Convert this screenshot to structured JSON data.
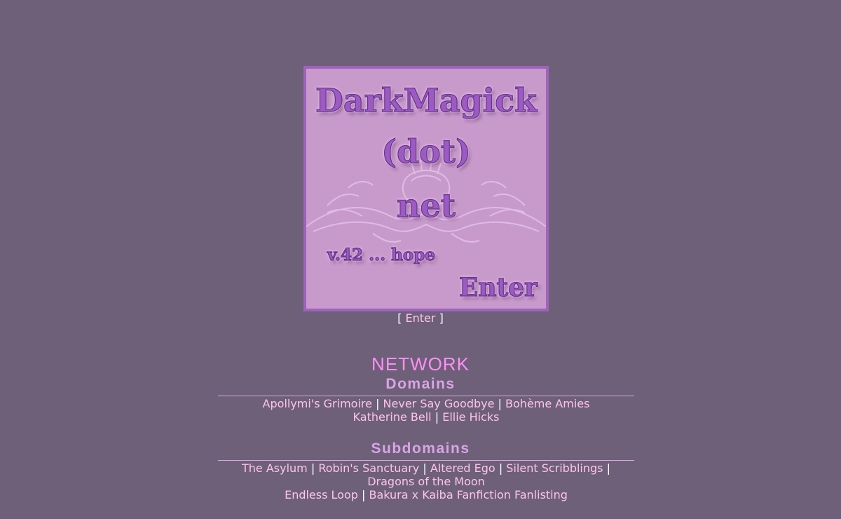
{
  "splash": {
    "line1": "DarkMagick",
    "line2": "(dot)",
    "line3": "net",
    "version": "v.42 ... hope",
    "enter_graphic": "Enter",
    "colors": {
      "panel": "#c89acb",
      "border": "#a062bd",
      "lettering": "#9c5bc2"
    }
  },
  "enter_link": {
    "open": "[",
    "label": "Enter",
    "close": "]"
  },
  "network": {
    "title": "NETWORK",
    "domains": {
      "title": "Domains",
      "rows": [
        [
          "Apollymi's Grimoire",
          "Never Say Goodbye",
          "Bohème Amies"
        ],
        [
          "Katherine Bell",
          "Ellie Hicks"
        ]
      ]
    },
    "subdomains": {
      "title": "Subdomains",
      "rows": [
        [
          "The Asylum",
          "Robin's Sanctuary",
          "Altered Ego",
          "Silent Scribblings"
        ],
        [
          "Dragons of the Moon"
        ],
        [
          "Endless Loop",
          "Bakura x Kaiba Fanfiction Fanlisting"
        ]
      ]
    }
  },
  "separator": "|",
  "colors": {
    "background": "#6e6079",
    "link": "#ffc4e8",
    "network_title": "#ff8ef5",
    "section_title": "#d9a4e6"
  }
}
